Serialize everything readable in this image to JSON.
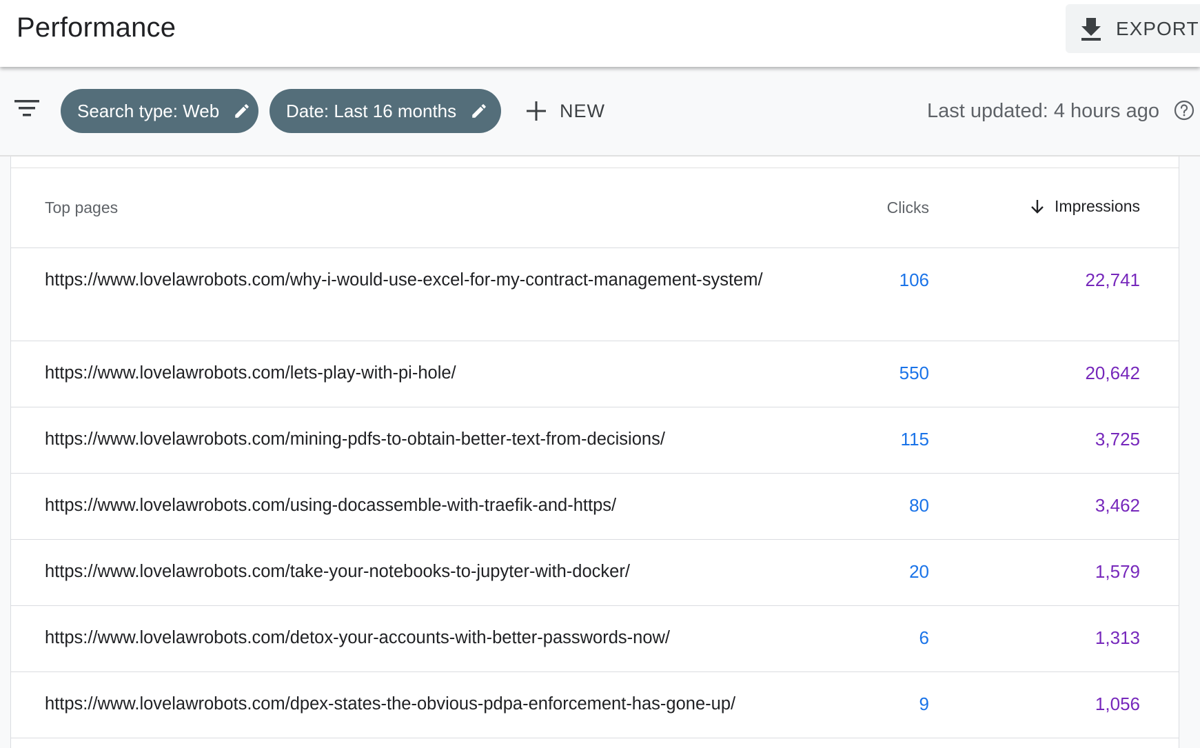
{
  "header": {
    "title": "Performance",
    "export_label": "EXPORT"
  },
  "filters": {
    "search_type_chip": "Search type: Web",
    "date_chip": "Date: Last 16 months",
    "new_label": "NEW",
    "last_updated": "Last updated: 4 hours ago"
  },
  "table": {
    "columns": {
      "page": "Top pages",
      "clicks": "Clicks",
      "impressions": "Impressions"
    },
    "rows": [
      {
        "url": "https://www.lovelawrobots.com/why-i-would-use-excel-for-my-contract-management-system/",
        "clicks": "106",
        "impressions": "22,741"
      },
      {
        "url": "https://www.lovelawrobots.com/lets-play-with-pi-hole/",
        "clicks": "550",
        "impressions": "20,642"
      },
      {
        "url": "https://www.lovelawrobots.com/mining-pdfs-to-obtain-better-text-from-decisions/",
        "clicks": "115",
        "impressions": "3,725"
      },
      {
        "url": "https://www.lovelawrobots.com/using-docassemble-with-traefik-and-https/",
        "clicks": "80",
        "impressions": "3,462"
      },
      {
        "url": "https://www.lovelawrobots.com/take-your-notebooks-to-jupyter-with-docker/",
        "clicks": "20",
        "impressions": "1,579"
      },
      {
        "url": "https://www.lovelawrobots.com/detox-your-accounts-with-better-passwords-now/",
        "clicks": "6",
        "impressions": "1,313"
      },
      {
        "url": "https://www.lovelawrobots.com/dpex-states-the-obvious-pdpa-enforcement-has-gone-up/",
        "clicks": "9",
        "impressions": "1,056"
      }
    ]
  },
  "colors": {
    "chip_bg": "#546e7a",
    "clicks": "#1a73e8",
    "impressions": "#7627bb"
  },
  "icons": {
    "export": "download-icon",
    "filter": "filter-list-icon",
    "edit": "pencil-icon",
    "new": "plus-icon",
    "help": "help-circle-icon",
    "sort": "arrow-down-icon"
  }
}
